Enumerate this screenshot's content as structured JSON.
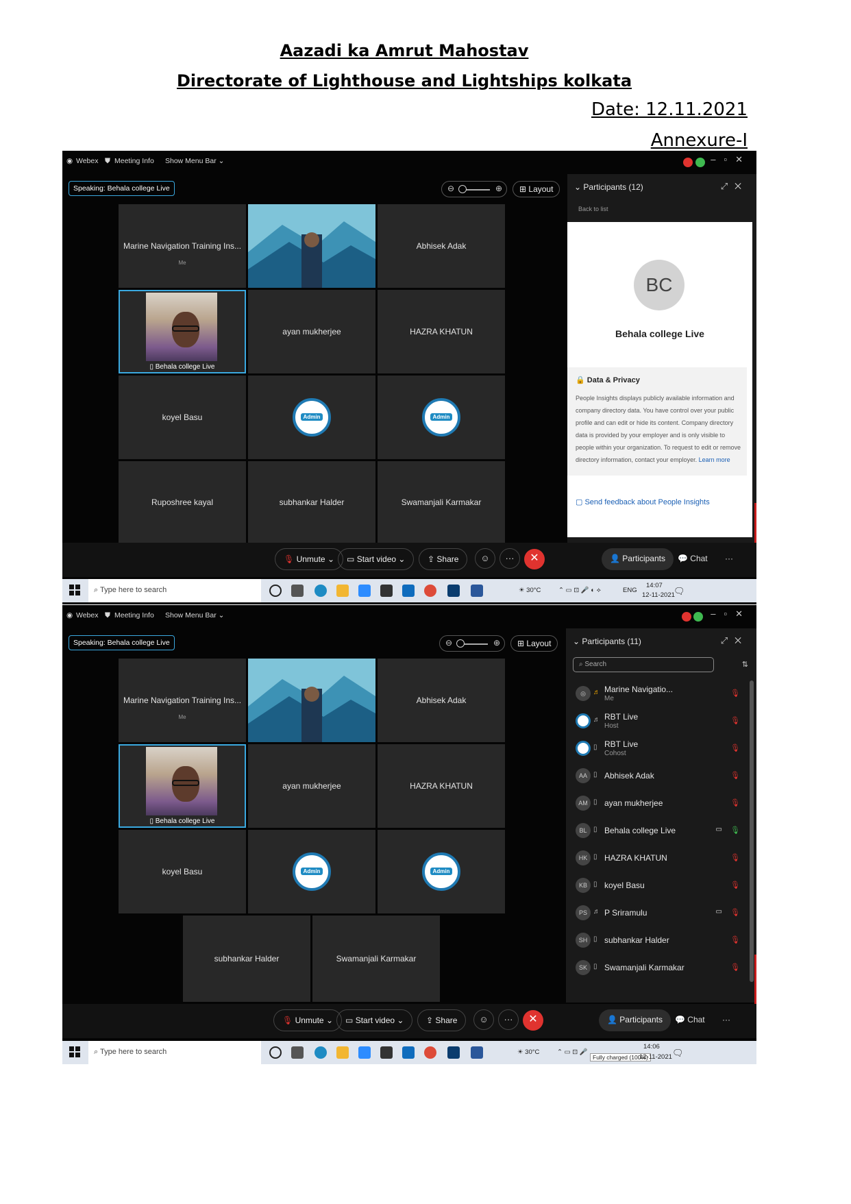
{
  "document": {
    "title": "Aazadi ka Amrut Mahostav",
    "subtitle": "Directorate of Lighthouse and Lightships kolkata",
    "date": "Date: 12.11.2021",
    "annexure": "Annexure-I"
  },
  "common": {
    "app_name": "Webex",
    "meeting_info": "Meeting Info",
    "show_menu_bar": "Show Menu Bar",
    "speaking": "Speaking: Behala college Live",
    "layout": "Layout",
    "unmute": "Unmute",
    "start_video": "Start video",
    "share": "Share",
    "participants_btn": "Participants",
    "chat": "Chat",
    "more": "···",
    "me": "Me",
    "admin": "Admin",
    "taskbar_search": "Type here to search",
    "weather": "30°C",
    "lang": "ENG"
  },
  "screen1": {
    "panel_title": "Participants (12)",
    "back_to_list": "Back to list",
    "card_initials": "BC",
    "card_name": "Behala college Live",
    "privacy_heading": "Data & Privacy",
    "privacy_text": "People Insights displays publicly available information and company directory data. You have control over your public profile and can edit or hide its content. Company directory data is provided by your employer and is only visible to people within your organization. To request to edit or remove directory information, contact your employer.",
    "learn_more": "Learn more",
    "feedback": "Send feedback about People Insights",
    "tiles": [
      "Marine Navigation Training Ins...",
      "Abhisek Adak",
      "Behala college Live",
      "ayan mukherjee",
      "HAZRA KHATUN",
      "koyel Basu",
      "Ruposhree kayal",
      "subhankar Halder",
      "Swamanjali Karmakar"
    ],
    "clock_time": "14:07",
    "clock_date": "12-11-2021"
  },
  "screen2": {
    "panel_title": "Participants (11)",
    "search_placeholder": "Search",
    "tiles": [
      "Marine Navigation Training Ins...",
      "Abhisek Adak",
      "Behala college Live",
      "ayan mukherjee",
      "HAZRA KHATUN",
      "koyel Basu",
      "subhankar Halder",
      "Swamanjali Karmakar"
    ],
    "participants": [
      {
        "initials": "",
        "name": "Marine Navigatio...",
        "role": "Me"
      },
      {
        "initials": "",
        "name": "RBT Live",
        "role": "Host"
      },
      {
        "initials": "",
        "name": "RBT Live",
        "role": "Cohost"
      },
      {
        "initials": "AA",
        "name": "Abhisek Adak",
        "role": ""
      },
      {
        "initials": "AM",
        "name": "ayan mukherjee",
        "role": ""
      },
      {
        "initials": "BL",
        "name": "Behala college Live",
        "role": ""
      },
      {
        "initials": "HK",
        "name": "HAZRA KHATUN",
        "role": ""
      },
      {
        "initials": "KB",
        "name": "koyel Basu",
        "role": ""
      },
      {
        "initials": "PS",
        "name": "P Sriramulu",
        "role": ""
      },
      {
        "initials": "SH",
        "name": "subhankar Halder",
        "role": ""
      },
      {
        "initials": "SK",
        "name": "Swamanjali Karmakar",
        "role": ""
      }
    ],
    "tooltip": "Fully charged (100%)",
    "clock_time": "14:06",
    "clock_date": "12-11-2021"
  }
}
